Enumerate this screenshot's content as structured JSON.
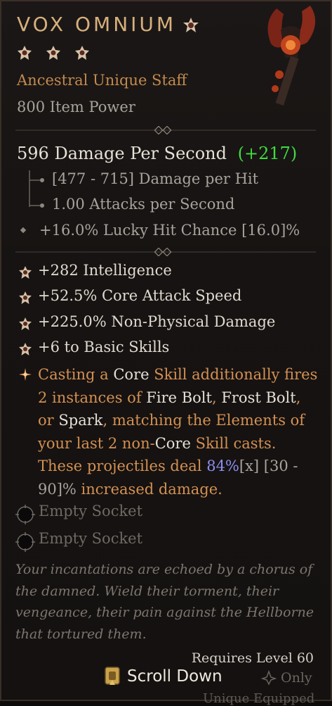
{
  "item": {
    "name": "VOX OMNIUM",
    "type": "Ancestral Unique Staff",
    "item_power": "800 Item Power",
    "image_icon": "staff-icon"
  },
  "weapon_stats": {
    "dps": "596 Damage Per Second",
    "dps_delta": "(+217)",
    "hit_damage": "[477 - 715] Damage per Hit",
    "attack_speed": "1.00 Attacks per Second",
    "implicit": "+16.0% Lucky Hit Chance [16.0]%"
  },
  "affixes": [
    "+282 Intelligence",
    "+52.5% Core Attack Speed",
    "+225.0% Non-Physical Damage",
    "+6 to Basic Skills"
  ],
  "unique_power": {
    "p1": "Casting a ",
    "w1": "Core",
    "p2": " Skill additionally fires 2 instances of ",
    "w2": "Fire Bolt",
    "p3": ", ",
    "w3": "Frost Bolt",
    "p4": ", or ",
    "w4": "Spark",
    "p5": ", matching the Elements of your last 2 non-",
    "w5": "Core",
    "p6": " Skill casts. These projectiles deal ",
    "b1": "84%",
    "g1": "[x] [30 - 90]%",
    "p7": " increased damage."
  },
  "sockets": [
    "Empty Socket",
    "Empty Socket"
  ],
  "flavor": "Your incantations are echoed by a chorus of the damned. Wield their torment, their vengeance, their pain against the Hellborne that tortured them.",
  "requirements": "Requires Level 60",
  "footer": {
    "scroll_label": "Scroll Down",
    "class_only": "Only",
    "equipped": "Unique Equipped"
  },
  "colors": {
    "title": "#d7b07c",
    "type": "#c28a4f",
    "unique_text": "#d49052",
    "positive": "#3fdc3f",
    "roll_value": "#8f8ff0"
  }
}
